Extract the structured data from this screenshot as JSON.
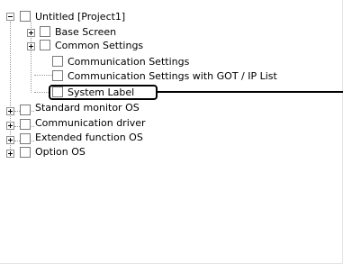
{
  "tree": {
    "root": {
      "label": "Untitled [Project1]"
    },
    "project_children": [
      {
        "label": "Base Screen"
      },
      {
        "label": "Common Settings"
      },
      {
        "label": "Communication Settings"
      },
      {
        "label": "Communication Settings with GOT / IP List"
      },
      {
        "label": "System Label"
      }
    ],
    "top_nodes": [
      {
        "label": "Standard monitor OS"
      },
      {
        "label": "Communication driver"
      },
      {
        "label": "Extended function OS"
      },
      {
        "label": "Option OS"
      }
    ]
  }
}
